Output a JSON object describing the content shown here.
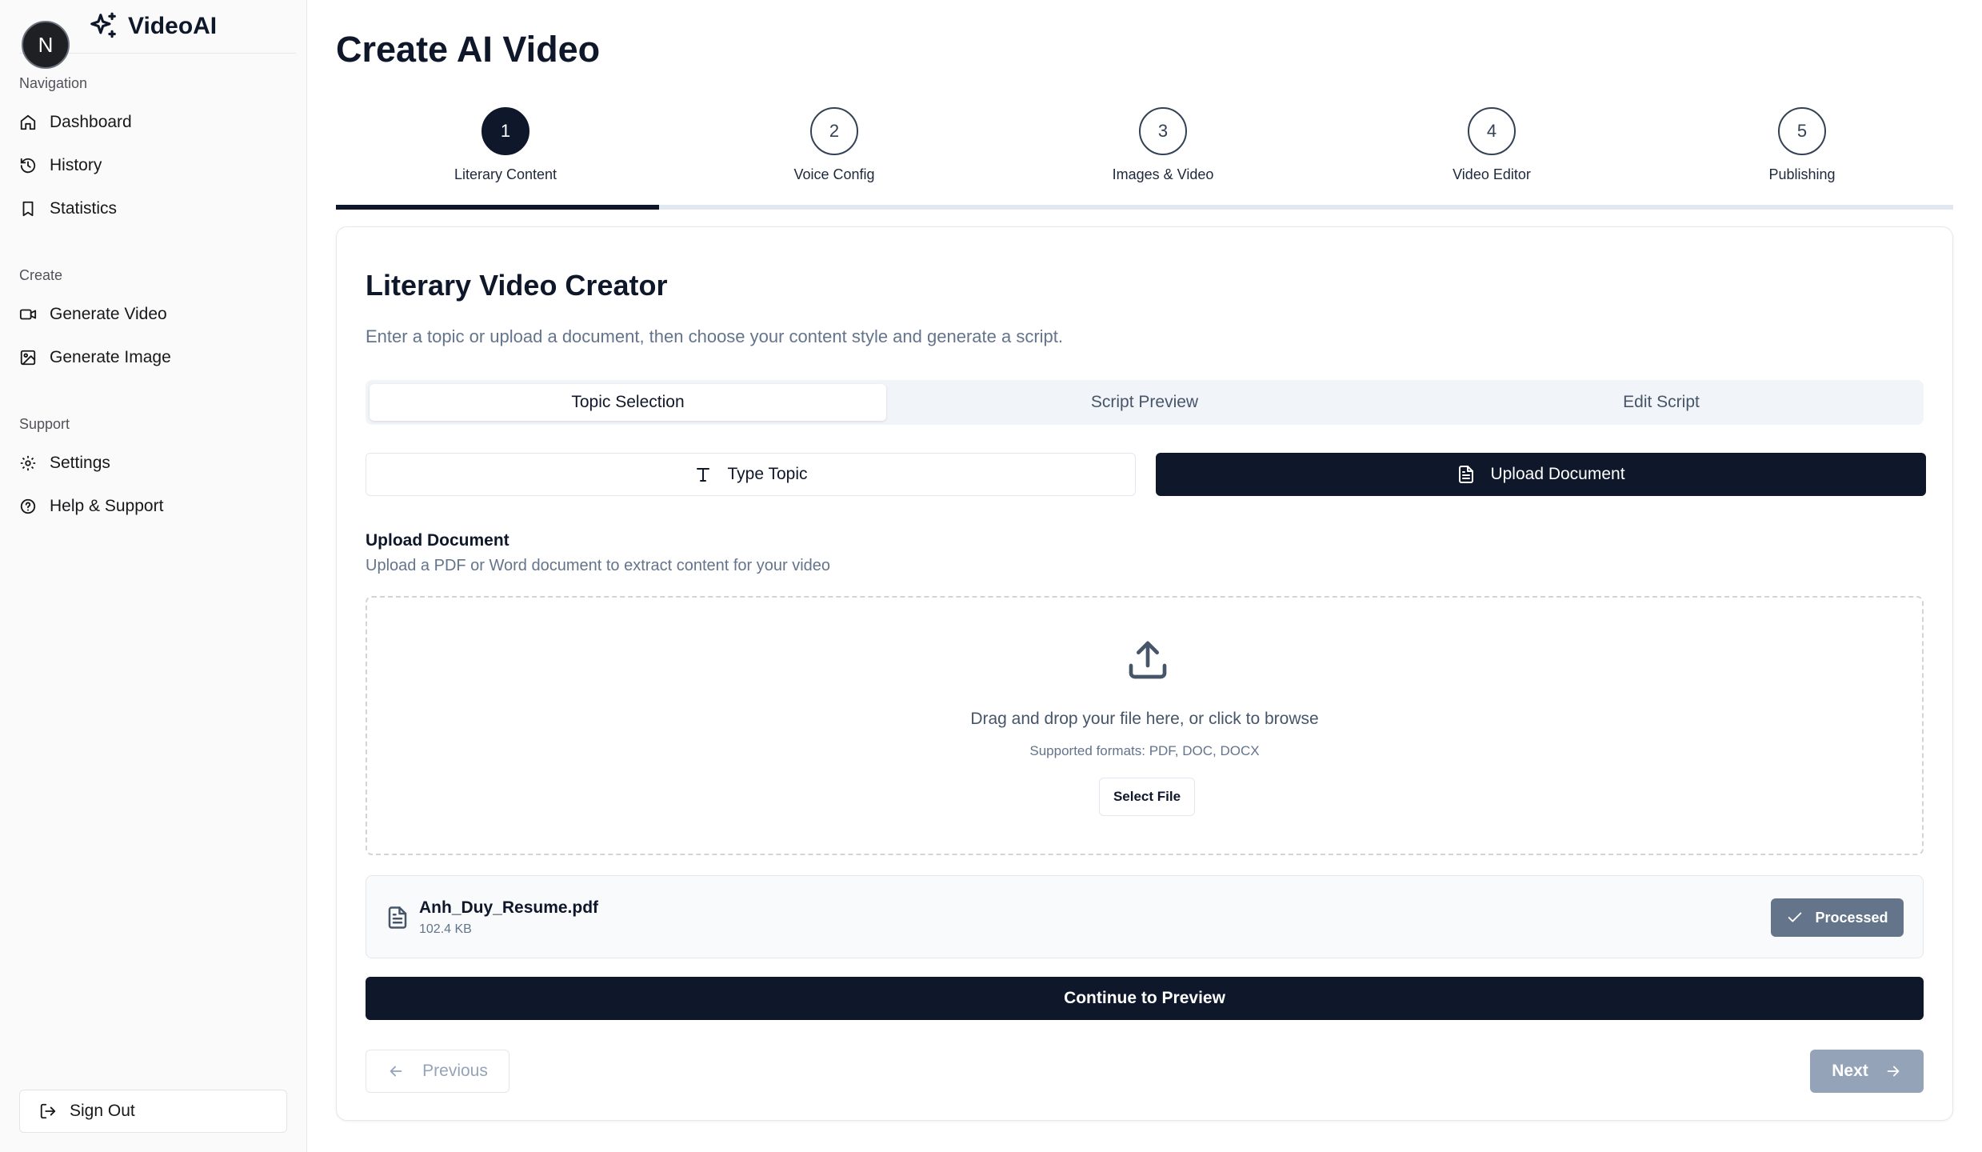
{
  "app": {
    "name": "VideoAI",
    "avatar_initial": "N"
  },
  "sidebar": {
    "sections": [
      {
        "label": "Navigation",
        "items": [
          {
            "label": "Dashboard",
            "icon": "home-icon"
          },
          {
            "label": "History",
            "icon": "history-icon"
          },
          {
            "label": "Statistics",
            "icon": "bookmark-icon"
          }
        ]
      },
      {
        "label": "Create",
        "items": [
          {
            "label": "Generate Video",
            "icon": "video-icon"
          },
          {
            "label": "Generate Image",
            "icon": "image-icon"
          }
        ]
      },
      {
        "label": "Support",
        "items": [
          {
            "label": "Settings",
            "icon": "gear-icon"
          },
          {
            "label": "Help & Support",
            "icon": "help-circle-icon"
          }
        ]
      }
    ],
    "sign_out": "Sign Out"
  },
  "page": {
    "title": "Create AI Video"
  },
  "stepper": {
    "steps": [
      {
        "number": "1",
        "label": "Literary Content",
        "active": true
      },
      {
        "number": "2",
        "label": "Voice Config",
        "active": false
      },
      {
        "number": "3",
        "label": "Images & Video",
        "active": false
      },
      {
        "number": "4",
        "label": "Video Editor",
        "active": false
      },
      {
        "number": "5",
        "label": "Publishing",
        "active": false
      }
    ],
    "progress_fraction": 0.2
  },
  "card": {
    "title": "Literary Video Creator",
    "description": "Enter a topic or upload a document, then choose your content style and generate a script.",
    "tabs": [
      {
        "label": "Topic Selection",
        "active": true
      },
      {
        "label": "Script Preview",
        "active": false
      },
      {
        "label": "Edit Script",
        "active": false
      }
    ],
    "mode_buttons": {
      "type_topic": "Type Topic",
      "upload_document": "Upload Document",
      "selected": "upload_document"
    },
    "upload": {
      "label": "Upload Document",
      "help": "Upload a PDF or Word document to extract content for your video",
      "dropzone_text": "Drag and drop your file here, or click to browse",
      "formats": "Supported formats: PDF, DOC, DOCX",
      "select_button": "Select File"
    },
    "file": {
      "name": "Anh_Duy_Resume.pdf",
      "size": "102.4 KB",
      "status": "Processed"
    },
    "continue_button": "Continue to Preview",
    "previous_button": "Previous",
    "next_button": "Next"
  },
  "colors": {
    "primary": "#0f172a",
    "muted_text": "#64748b",
    "status_badge": "#64748b",
    "disabled_button": "#94a3b8"
  }
}
